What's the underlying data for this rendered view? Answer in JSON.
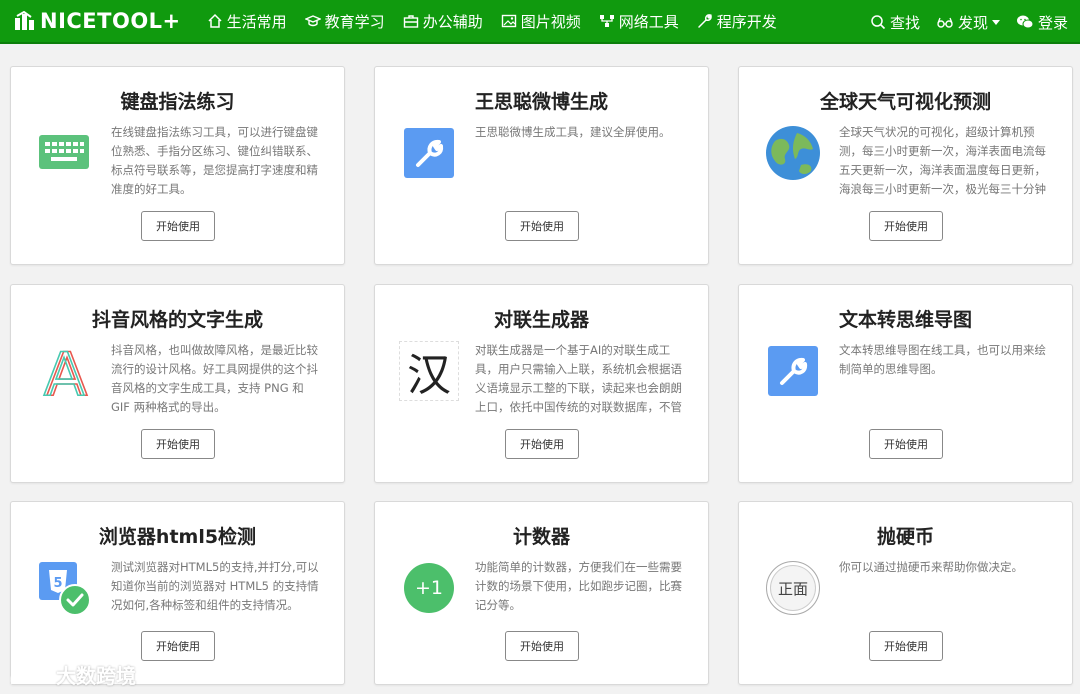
{
  "brand": {
    "name": "NICETOOL+"
  },
  "nav": {
    "items": [
      {
        "label": "生活常用",
        "icon": "home-icon"
      },
      {
        "label": "教育学习",
        "icon": "graduation-cap-icon"
      },
      {
        "label": "办公辅助",
        "icon": "briefcase-icon"
      },
      {
        "label": "图片视频",
        "icon": "image-icon"
      },
      {
        "label": "网络工具",
        "icon": "network-icon"
      },
      {
        "label": "程序开发",
        "icon": "wrench-icon"
      }
    ],
    "right": [
      {
        "label": "查找",
        "icon": "search-icon"
      },
      {
        "label": "发现",
        "icon": "glasses-icon"
      },
      {
        "label": "登录",
        "icon": "wechat-icon"
      }
    ]
  },
  "cards": [
    {
      "title": "键盘指法练习",
      "icon": "keyboard-icon",
      "desc": "在线键盘指法练习工具，可以进行键盘键位熟悉、手指分区练习、键位纠错联系、标点符号联系等，是您提高打字速度和精准度的好工具。",
      "button": "开始使用"
    },
    {
      "title": "王思聪微博生成",
      "icon": "wrench-tile-icon",
      "desc": "王思聪微博生成工具，建议全屏使用。",
      "button": "开始使用"
    },
    {
      "title": "全球天气可视化预测",
      "icon": "globe-icon",
      "desc": "全球天气状况的可视化，超级计算机预测，每三小时更新一次，海洋表面电流每五天更新一次，海洋表面温度每日更新，海浪每三小时更新一次，极光每三十分钟",
      "button": "开始使用"
    },
    {
      "title": "抖音风格的文字生成",
      "icon": "glitch-letter-a-icon",
      "icon_text": "A",
      "desc": "抖音风格，也叫做故障风格，是最近比较流行的设计风格。好工具网提供的这个抖音风格的文字生成工具，支持 PNG 和 GIF 两种格式的导出。",
      "button": "开始使用"
    },
    {
      "title": "对联生成器",
      "icon": "han-character-icon",
      "icon_text": "汉",
      "desc": "对联生成器是一个基于AI的对联生成工具，用户只需输入上联，系统机会根据语义语境显示工整的下联，读起来也会朗朗上口，依托中国传统的对联数据库，不管",
      "button": "开始使用"
    },
    {
      "title": "文本转思维导图",
      "icon": "wrench-tile-icon",
      "desc": "文本转思维导图在线工具，也可以用来绘制简单的思维导图。",
      "button": "开始使用"
    },
    {
      "title": "浏览器html5检测",
      "icon": "html5-check-icon",
      "icon_text": "5",
      "desc": "测试浏览器对HTML5的支持,并打分,可以知道你当前的浏览器对 HTML5 的支持情况如何,各种标签和组件的支持情况。",
      "button": "开始使用"
    },
    {
      "title": "计数器",
      "icon": "plus-one-icon",
      "icon_text": "+1",
      "desc": "功能简单的计数器，方便我们在一些需要计数的场景下使用，比如跑步记圈，比赛记分等。",
      "button": "开始使用"
    },
    {
      "title": "抛硬币",
      "icon": "coin-icon",
      "icon_text": "正面",
      "desc": "你可以通过抛硬币来帮助你做决定。",
      "button": "开始使用"
    }
  ],
  "watermark": {
    "text": "大数跨境"
  }
}
